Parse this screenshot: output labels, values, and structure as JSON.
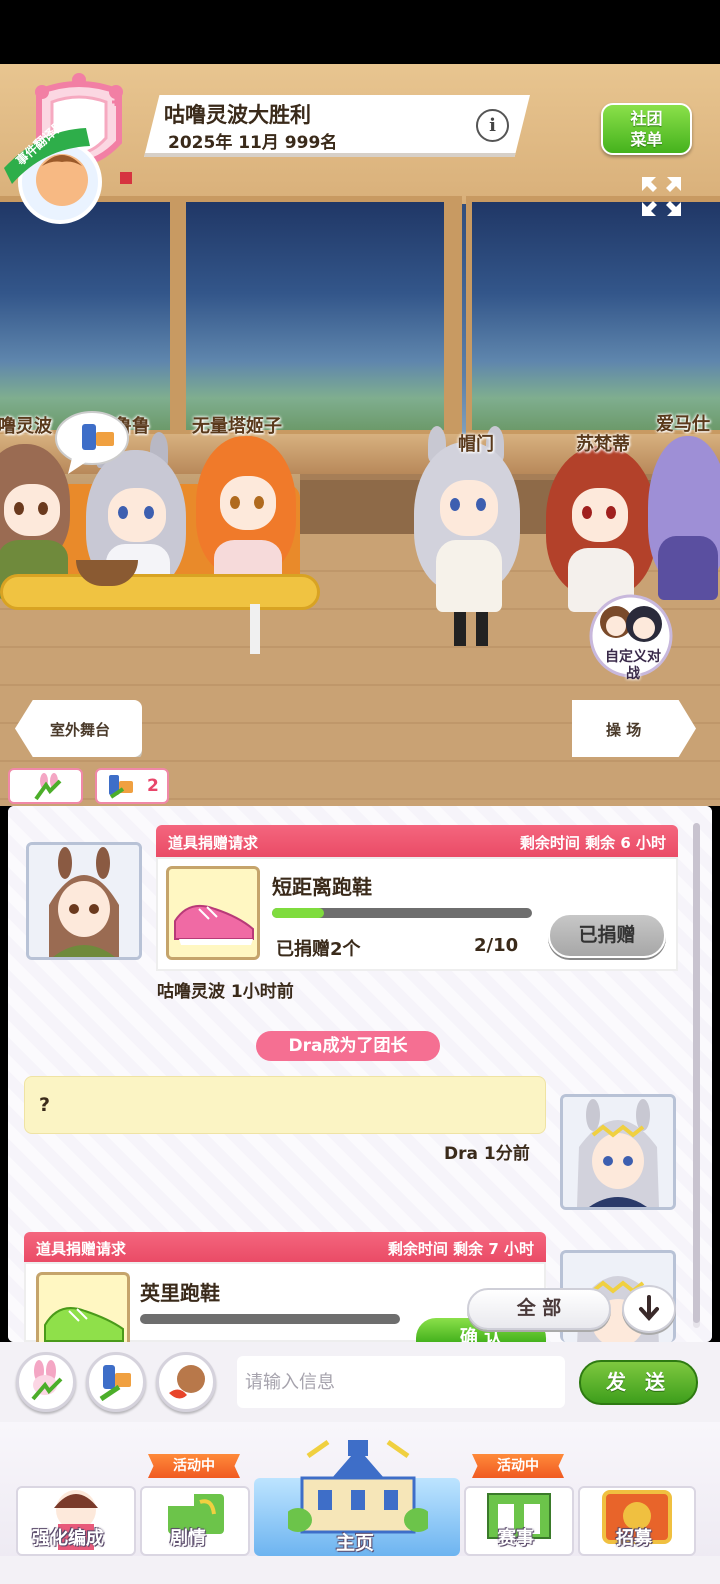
{
  "header": {
    "club_name": "咕噜灵波大胜利",
    "period": "2025年 11月 999名",
    "info_label": "i",
    "menu_label": "社团菜单"
  },
  "scene": {
    "characters": [
      {
        "name": "噜灵波"
      },
      {
        "name": "鲁鲁"
      },
      {
        "name": "无量塔姬子"
      },
      {
        "name": "帽门"
      },
      {
        "name": "苏梵蒂"
      },
      {
        "name": "爱马仕"
      }
    ],
    "nav_left": "室外舞台",
    "nav_right": "操 场",
    "custom_battle": "自定义对战",
    "mini_tab_count": "2",
    "pass_badge": "事件翻译器"
  },
  "chat": {
    "messages": [
      {
        "type": "donation",
        "header": "道具捐赠请求",
        "time_left": "剩余时间 剩余 6 小时",
        "item": "短距离跑鞋",
        "donated_text": "已捐赠2个",
        "progress_text": "2/10",
        "progress": 0.2,
        "button": "已捐赠",
        "author_time": "咕噜灵波 1小时前"
      },
      {
        "type": "system",
        "text": "Dra成为了团长"
      },
      {
        "type": "text",
        "text": "?",
        "author_time": "Dra 1分前"
      },
      {
        "type": "donation",
        "header": "道具捐赠请求",
        "time_left": "剩余时间 剩余 7 小时",
        "item": "英里跑鞋",
        "progress": 0.0,
        "button": "确 认"
      }
    ],
    "filter_label": "全 部"
  },
  "input": {
    "placeholder": "请输入信息",
    "send_label": "发 送"
  },
  "bottom_nav": {
    "tabs": [
      {
        "label": "强化编成"
      },
      {
        "label": "剧情",
        "flag": "活动中"
      },
      {
        "label": "主页"
      },
      {
        "label": "赛事",
        "flag": "活动中"
      },
      {
        "label": "招募"
      }
    ]
  },
  "colors": {
    "card_header": "#ea4b66",
    "accent_green": "#45b21d",
    "system_pill": "#f56f92",
    "progress_fill": "#7fdc3e",
    "bubble": "#fbf4c4"
  }
}
